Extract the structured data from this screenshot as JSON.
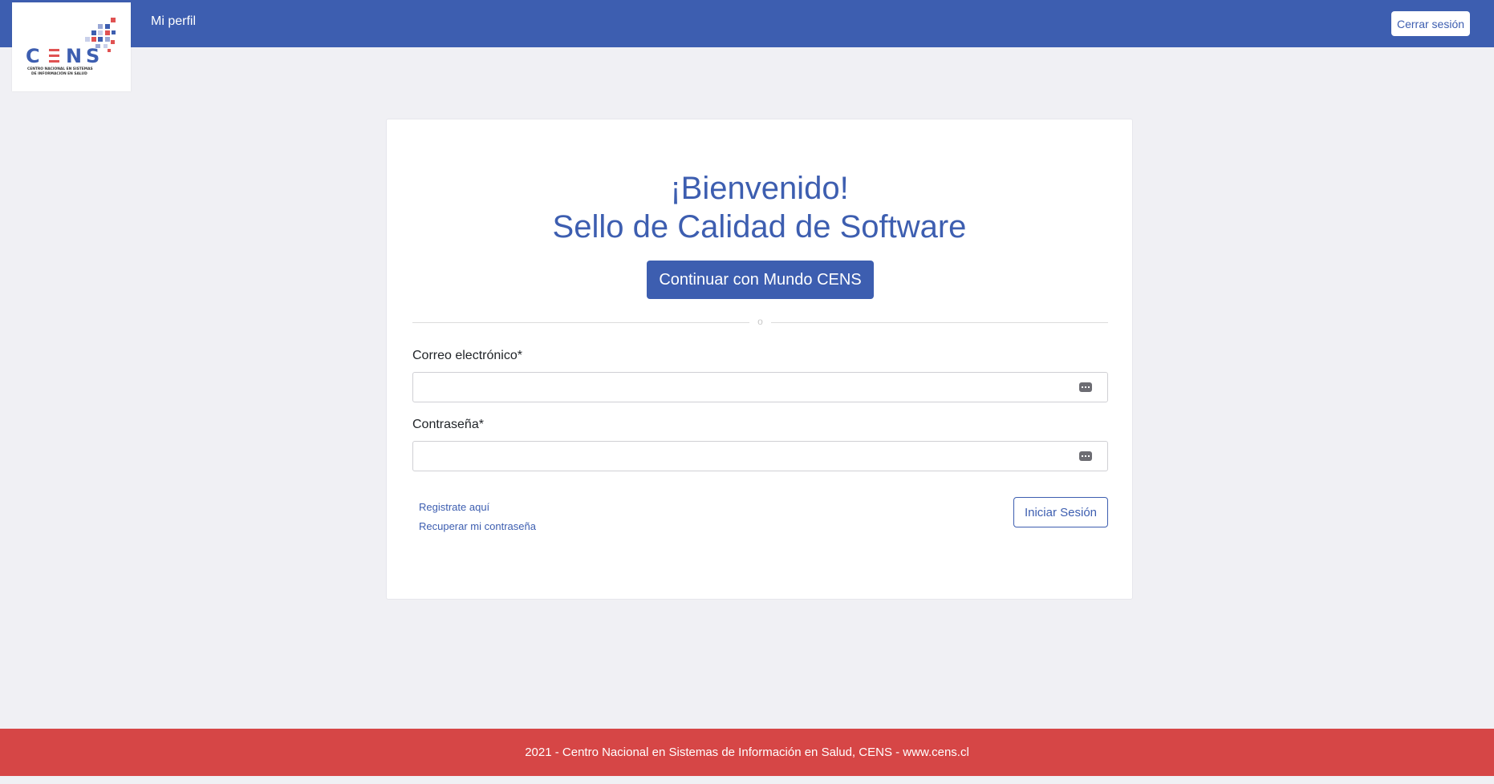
{
  "header": {
    "brand_logo": {
      "name": "CENS",
      "subtitle_line_1": "CENTRO NACIONAL EN SISTEMAS",
      "subtitle_line_2": "DE INFORMACIÓN EN SALUD"
    },
    "nav_profile_label": "Mi perfil",
    "logout_label": "Cerrar sesión"
  },
  "login_card": {
    "title_line_1": "¡Bienvenido!",
    "title_line_2": "Sello de Calidad de Software",
    "sso_button_label": "Continuar con Mundo CENS",
    "divider_text": "o",
    "email_label": "Correo electrónico*",
    "email_value": "",
    "email_icon": "password-manager-key-icon",
    "password_label": "Contraseña*",
    "password_value": "",
    "password_icon": "password-manager-key-icon",
    "register_link": "Registrate aquí",
    "recover_link": "Recuperar mi contraseña",
    "login_button_label": "Iniciar Sesión"
  },
  "footer": {
    "text": "2021 - Centro Nacional en Sistemas de Información en Salud, CENS - www.cens.cl"
  },
  "colors": {
    "primary": "#3d5eb0",
    "footer": "#d64646",
    "background": "#f0f0f4",
    "logo_accent_red": "#e05252",
    "logo_accent_blue": "#3d5eb0"
  }
}
